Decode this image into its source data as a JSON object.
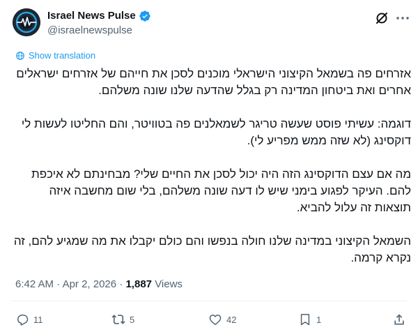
{
  "user": {
    "display_name": "Israel News Pulse",
    "handle": "@israelnewspulse",
    "verified": true,
    "verified_color": "#1d9bf0"
  },
  "header_icons": [
    "grok-icon",
    "more-icon"
  ],
  "translation": {
    "label": "Show translation",
    "icon": "globe-icon"
  },
  "tweet": {
    "paragraphs": [
      "אזרחים פה בשמאל הקיצוני הישראלי מוכנים לסכן את חייהם של אזרחים ישראלים אחרים ואת ביטחון המדינה רק בגלל שהדעה שלנו שונה משלהם.",
      "דוגמה: עשיתי פוסט שעשה טריגר לשמאלנים פה בטוויטר, והם החליטו לעשות לי דוקסינג (לא שזה ממש מפריע לי).",
      "מה אם עצם הדוקסינג הזה היה יכול לסכן את החיים שלי? מבחינתם לא איכפת להם. העיקר לפגוע בימני שיש לו דעה שונה משלהם, בלי שום מחשבה איזה תוצאות זה עלול להביא.",
      "השמאל הקיצוני במדינה שלנו חולה בנפשו והם כולם יקבלו את מה שמגיע להם, זה נקרא קרמה."
    ]
  },
  "meta": {
    "time": "6:42 AM",
    "separator": "·",
    "date": "Apr 2, 2026",
    "views_count": "1,887",
    "views_label": "Views"
  },
  "actions": {
    "reply_count": "11",
    "repost_count": "5",
    "like_count": "42",
    "bookmark_count": "1"
  },
  "colors": {
    "text": "#0f1419",
    "secondary": "#536471",
    "link": "#1d9bf0",
    "divider": "#eff3f4"
  }
}
